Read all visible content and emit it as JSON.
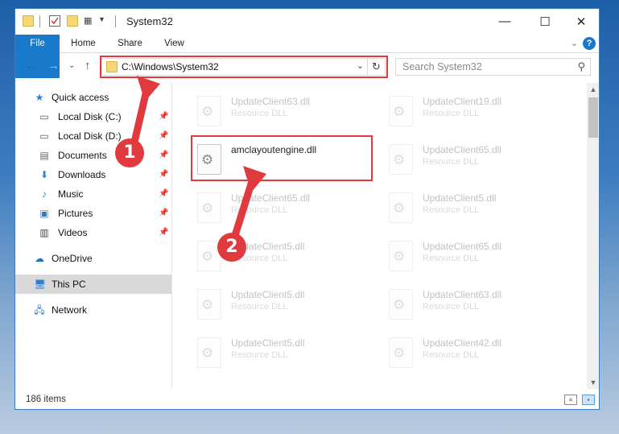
{
  "window": {
    "title": "System32"
  },
  "window_controls": {
    "minimize": "—",
    "maximize": "☐",
    "close": "✕"
  },
  "ribbon": {
    "tabs": [
      "File",
      "Home",
      "Share",
      "View"
    ],
    "help": "?"
  },
  "address_bar": {
    "path": "C:\\Windows\\System32"
  },
  "search": {
    "placeholder": "Search System32"
  },
  "sidebar": {
    "quick_access": "Quick access",
    "items": [
      {
        "label": "Local Disk (C:)",
        "icon": "drive-icon",
        "pinned": true
      },
      {
        "label": "Local Disk (D:)",
        "icon": "drive-icon",
        "pinned": true
      },
      {
        "label": "Documents",
        "icon": "documents-icon",
        "pinned": true
      },
      {
        "label": "Downloads",
        "icon": "downloads-icon",
        "pinned": true
      },
      {
        "label": "Music",
        "icon": "music-icon",
        "pinned": true
      },
      {
        "label": "Pictures",
        "icon": "pictures-icon",
        "pinned": true
      },
      {
        "label": "Videos",
        "icon": "videos-icon",
        "pinned": true
      }
    ],
    "onedrive": "OneDrive",
    "this_pc": "This PC",
    "network": "Network"
  },
  "files_left": [
    {
      "name": "UpdateClient63.dll",
      "type": "Resource DLL"
    },
    {
      "name": "amclayoutengine.dll",
      "type": ""
    },
    {
      "name": "UpdateClient65.dll",
      "type": "Resource DLL"
    },
    {
      "name": "UpdateClient5.dll",
      "type": "Resource DLL"
    },
    {
      "name": "UpdateClient5.dll",
      "type": "Resource DLL"
    },
    {
      "name": "UpdateClient5.dll",
      "type": "Resource DLL"
    }
  ],
  "files_right": [
    {
      "name": "UpdateClient19.dll",
      "type": "Resource DLL"
    },
    {
      "name": "UpdateClient65.dll",
      "type": "Resource DLL"
    },
    {
      "name": "UpdateClient5.dll",
      "type": "Resource DLL"
    },
    {
      "name": "UpdateClient65.dll",
      "type": "Resource DLL"
    },
    {
      "name": "UpdateClient63.dll",
      "type": "Resource DLL"
    },
    {
      "name": "UpdateClient42.dll",
      "type": "Resource DLL"
    }
  ],
  "status": {
    "item_count": "186 items"
  },
  "annotations": {
    "step1": "1",
    "step2": "2",
    "color": "#e0393e"
  }
}
